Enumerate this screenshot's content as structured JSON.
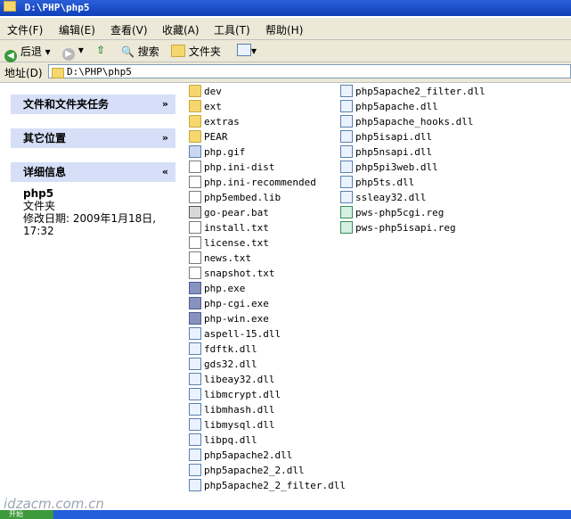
{
  "window": {
    "title": "D:\\PHP\\php5"
  },
  "menu": [
    "文件(F)",
    "编辑(E)",
    "查看(V)",
    "收藏(A)",
    "工具(T)",
    "帮助(H)"
  ],
  "toolbar": {
    "back": "后退",
    "search": "搜索",
    "folders": "文件夹"
  },
  "address": {
    "label": "地址(D)",
    "value": "D:\\PHP\\php5"
  },
  "tasks": {
    "file_tasks": "文件和文件夹任务",
    "other_places": "其它位置",
    "details": "详细信息",
    "detail_name": "php5",
    "detail_type": "文件夹",
    "detail_modified": "修改日期: 2009年1月18日, 17:32"
  },
  "files_col1": [
    {
      "name": "dev",
      "icon": "folder"
    },
    {
      "name": "ext",
      "icon": "folder"
    },
    {
      "name": "extras",
      "icon": "folder"
    },
    {
      "name": "PEAR",
      "icon": "folder"
    },
    {
      "name": "php.gif",
      "icon": "img"
    },
    {
      "name": "php.ini-dist",
      "icon": "doc"
    },
    {
      "name": "php.ini-recommended",
      "icon": "doc"
    },
    {
      "name": "php5embed.lib",
      "icon": "doc"
    },
    {
      "name": "go-pear.bat",
      "icon": "bat"
    },
    {
      "name": "install.txt",
      "icon": "doc"
    },
    {
      "name": "license.txt",
      "icon": "doc"
    },
    {
      "name": "news.txt",
      "icon": "doc"
    },
    {
      "name": "snapshot.txt",
      "icon": "doc"
    },
    {
      "name": "php.exe",
      "icon": "php"
    },
    {
      "name": "php-cgi.exe",
      "icon": "php"
    },
    {
      "name": "php-win.exe",
      "icon": "php"
    },
    {
      "name": "aspell-15.dll",
      "icon": "dll"
    },
    {
      "name": "fdftk.dll",
      "icon": "dll"
    },
    {
      "name": "gds32.dll",
      "icon": "dll"
    },
    {
      "name": "libeay32.dll",
      "icon": "dll"
    },
    {
      "name": "libmcrypt.dll",
      "icon": "dll"
    },
    {
      "name": "libmhash.dll",
      "icon": "dll"
    },
    {
      "name": "libmysql.dll",
      "icon": "dll"
    },
    {
      "name": "libpq.dll",
      "icon": "dll"
    },
    {
      "name": "php5apache2.dll",
      "icon": "dll"
    },
    {
      "name": "php5apache2_2.dll",
      "icon": "dll"
    },
    {
      "name": "php5apache2_2_filter.dll",
      "icon": "dll"
    }
  ],
  "files_col2": [
    {
      "name": "php5apache2_filter.dll",
      "icon": "dll"
    },
    {
      "name": "php5apache.dll",
      "icon": "dll"
    },
    {
      "name": "php5apache_hooks.dll",
      "icon": "dll"
    },
    {
      "name": "php5isapi.dll",
      "icon": "dll"
    },
    {
      "name": "php5nsapi.dll",
      "icon": "dll"
    },
    {
      "name": "php5pi3web.dll",
      "icon": "dll"
    },
    {
      "name": "php5ts.dll",
      "icon": "dll"
    },
    {
      "name": "ssleay32.dll",
      "icon": "dll"
    },
    {
      "name": "pws-php5cgi.reg",
      "icon": "reg"
    },
    {
      "name": "pws-php5isapi.reg",
      "icon": "reg"
    }
  ],
  "watermark": "idzacm.com.cn",
  "taskbar": {
    "start": "开始"
  }
}
